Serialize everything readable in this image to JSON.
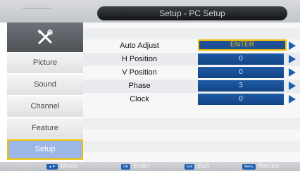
{
  "header": {
    "title": "Setup - PC Setup"
  },
  "sidebar": {
    "tools_icon": "tools-icon",
    "items": [
      {
        "label": "Picture"
      },
      {
        "label": "Sound"
      },
      {
        "label": "Channel"
      },
      {
        "label": "Feature"
      },
      {
        "label": "Setup",
        "active": true
      }
    ]
  },
  "settings": [
    {
      "label": "Auto Adjust",
      "value": "ENTER",
      "focused": true
    },
    {
      "label": "H Position",
      "value": "0"
    },
    {
      "label": "V Position",
      "value": "0"
    },
    {
      "label": "Phase",
      "value": "3"
    },
    {
      "label": "Clock",
      "value": "0"
    }
  ],
  "footer": {
    "hints": [
      {
        "key": "▲▼",
        "label": "Move"
      },
      {
        "key": "OK",
        "label": "Enter"
      },
      {
        "key": "Exit",
        "label": "Exit"
      },
      {
        "key": "Menu",
        "label": "Return"
      }
    ]
  },
  "colors": {
    "accent": "#f4c200",
    "value_bg": "#1e5aa6",
    "active_menu": "#9db8e6"
  }
}
